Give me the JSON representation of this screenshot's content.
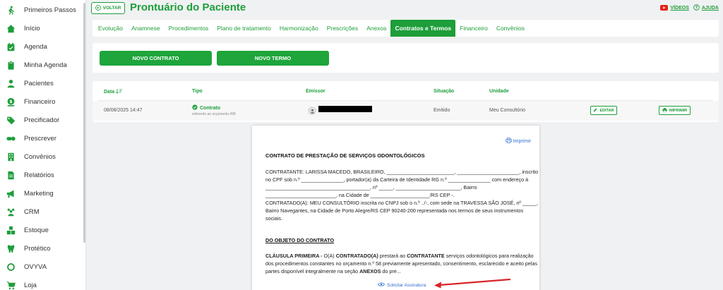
{
  "sidebar": {
    "items": [
      {
        "label": "Primeiros Passos",
        "icon": "walking-person-icon"
      },
      {
        "label": "Início",
        "icon": "home-icon"
      },
      {
        "label": "Agenda",
        "icon": "calendar-check-icon"
      },
      {
        "label": "Minha Agenda",
        "icon": "clipboard-icon"
      },
      {
        "label": "Pacientes",
        "icon": "person-icon"
      },
      {
        "label": "Financeiro",
        "icon": "money-icon"
      },
      {
        "label": "Precificador",
        "icon": "tag-icon"
      },
      {
        "label": "Prescrever",
        "icon": "pills-icon"
      },
      {
        "label": "Convênios",
        "icon": "building-icon"
      },
      {
        "label": "Relatórios",
        "icon": "document-icon"
      },
      {
        "label": "Marketing",
        "icon": "megaphone-icon"
      },
      {
        "label": "CRM",
        "icon": "users-icon"
      },
      {
        "label": "Estoque",
        "icon": "boxes-icon"
      },
      {
        "label": "Protético",
        "icon": "tooth-icon"
      },
      {
        "label": "OVYVA",
        "icon": "ring-icon"
      },
      {
        "label": "Loja",
        "icon": "cart-icon"
      }
    ]
  },
  "header": {
    "back_label": "VOLTAR",
    "title": "Prontuário do Paciente",
    "videos_label": "VÍDEOS",
    "help_label": "AJUDA"
  },
  "tabs": [
    {
      "label": "Evolução"
    },
    {
      "label": "Anamnese"
    },
    {
      "label": "Procedimentos"
    },
    {
      "label": "Plano de tratamento"
    },
    {
      "label": "Harmonização"
    },
    {
      "label": "Prescrições"
    },
    {
      "label": "Anexos"
    },
    {
      "label": "Contratos e Termos",
      "active": true
    },
    {
      "label": "Financeiro"
    },
    {
      "label": "Convênios"
    }
  ],
  "actions": {
    "new_contract": "NOVO CONTRATO",
    "new_term": "NOVO TERMO"
  },
  "table": {
    "headers": {
      "date": "Data",
      "type": "Tipo",
      "issuer": "Emissor",
      "status": "Situação",
      "unit": "Unidade"
    },
    "rows": [
      {
        "date": "08/08/2025 14:47",
        "type": "Contrato",
        "type_sub": "referente ao orçamento #58",
        "status": "Emitido",
        "unit": "Meu Consultório",
        "edit_label": "EDITAR",
        "print_label": "IMPRIMIR"
      }
    ]
  },
  "document": {
    "print_label": "Imprimir",
    "title": "CONTRATO DE PRESTAÇÃO DE SERVIÇOS ODONTOLÓGICOS",
    "paragraph_1": "CONTRATANTE: LARISSA MACEDO, BRASILEIRO, ________________________, ______________________, inscrito no CPF sob n.º _______________, portador(a) da Carteira de Identidade RG n.º _______________ com endereço à _____________________________________, nº _____, _______________________, Bairro _________________________, na Cidade de _____________________/RS CEP -.",
    "paragraph_2": "CONTRATADO(A): MEU CONSULTÓRIO inscrita no CNPJ sob o n.º ../-, com sede na TRAVESSA SÃO JOSÉ, nº _____, Bairro Navegantes, na Cidade de Porto Alegre/RS CEP 90240-200 representada nos termos de seus instrumentos sociais.",
    "section_title": "DO OBJETO DO CONTRATO",
    "clause_label": "CLÁUSULA PRIMEIRA -",
    "clause_text_1": " O(A) ",
    "clause_bold_1": "CONTRATADO(A)",
    "clause_text_2": " prestará ao ",
    "clause_bold_2": "CONTRATANTE",
    "clause_text_3": " serviços odontológicos para realização dos procedimentos constantes no orçamento n.º 58  previamente apresentado, consentimento, esclarecido e aceito pelas partes disponível integralmente na seção ",
    "clause_bold_3": "ANEXOS",
    "clause_text_4": " do pre...",
    "sign_label": "Solicitar Assinatura"
  },
  "colors": {
    "brand_green": "#1e9e3a",
    "link_blue": "#2f6fd1",
    "annotation_red": "#d9262a"
  }
}
